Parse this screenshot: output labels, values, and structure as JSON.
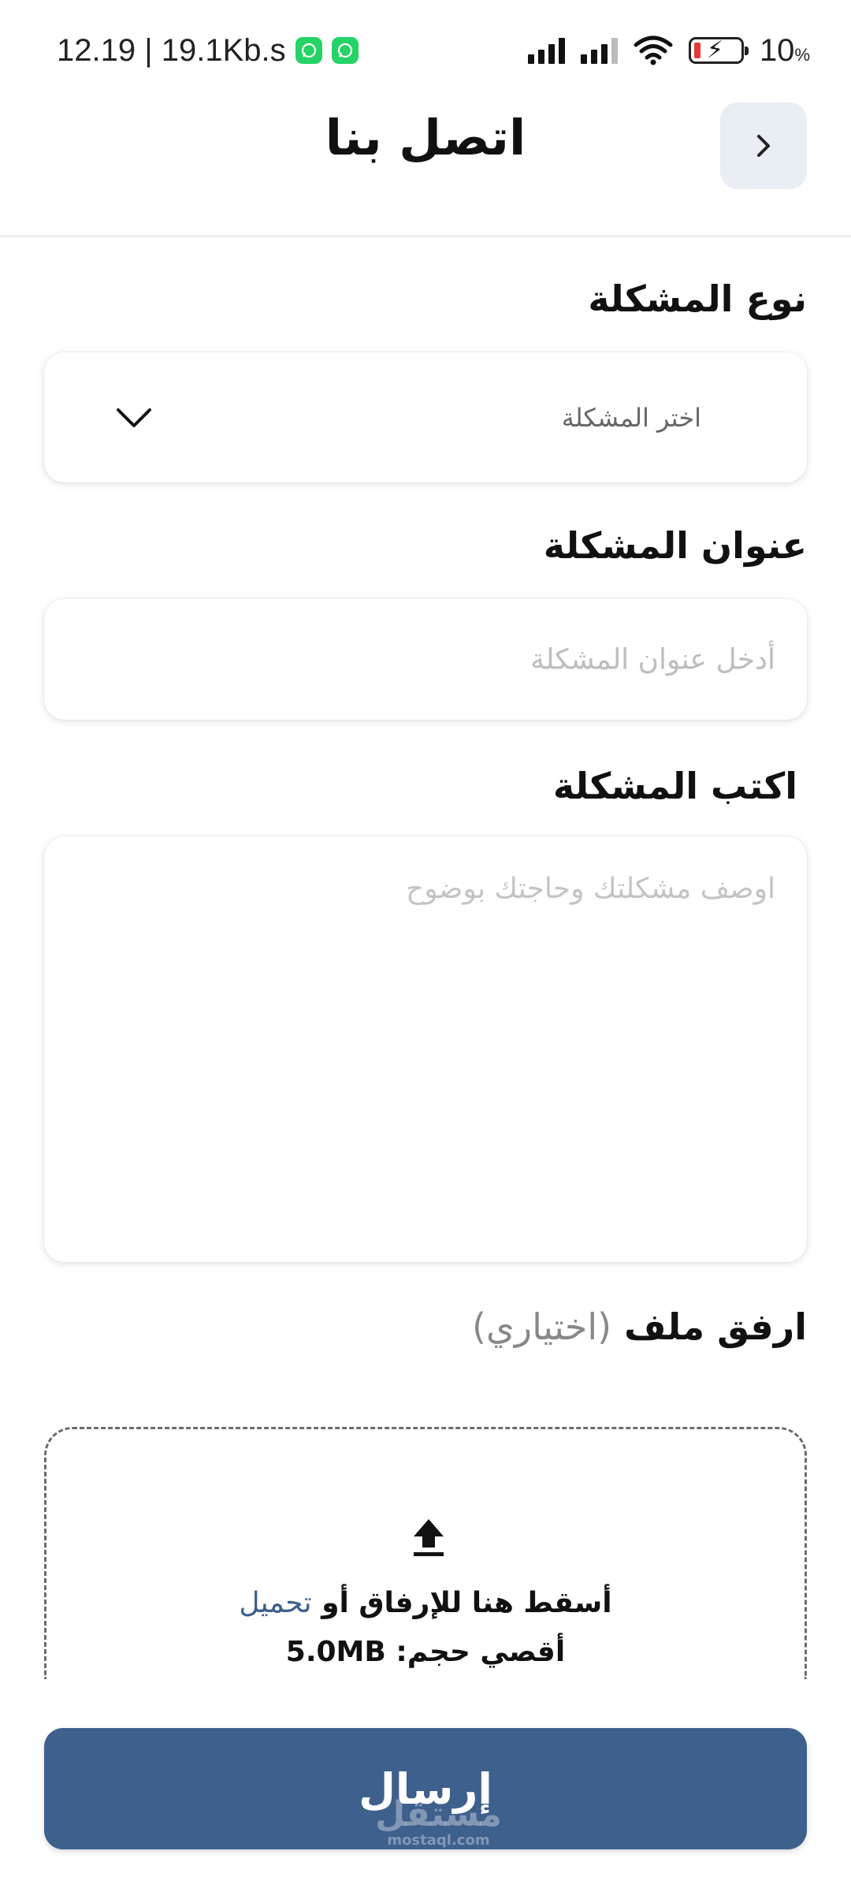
{
  "status_bar": {
    "time_speed": "12.19 | 19.1Kb.s",
    "battery_percent": "10",
    "battery_unit": "%",
    "notification_icons": [
      "whatsapp-icon",
      "whatsapp-icon"
    ],
    "system_icons": [
      "signal-icon",
      "signal-icon",
      "wifi-icon",
      "battery-charging-icon"
    ]
  },
  "header": {
    "title": "اتصل بنا",
    "back_icon": "chevron-right-icon"
  },
  "form": {
    "problem_type": {
      "label": "نوع المشكلة",
      "placeholder": "اختر المشكلة"
    },
    "problem_title": {
      "label": "عنوان المشكلة",
      "placeholder": "أدخل عنوان المشكلة"
    },
    "problem_description": {
      "label": "اكتب المشكلة",
      "placeholder": "اوصف مشكلتك وحاجتك بوضوح"
    },
    "attachment": {
      "label": "ارفق ملف",
      "optional": "(اختياري)",
      "drop_text": "أسقط هنا للإرفاق أو",
      "upload_link": "تحميل",
      "max_size_label": "أقصي حجم:",
      "max_size_value": "5.0MB"
    }
  },
  "submit_label": "إرسال",
  "watermark": {
    "brand": "مستقل",
    "domain": "mostaql.com"
  },
  "colors": {
    "primary": "#3e608d",
    "link": "#3d5f8c",
    "back_button_bg": "#e9eef4"
  }
}
